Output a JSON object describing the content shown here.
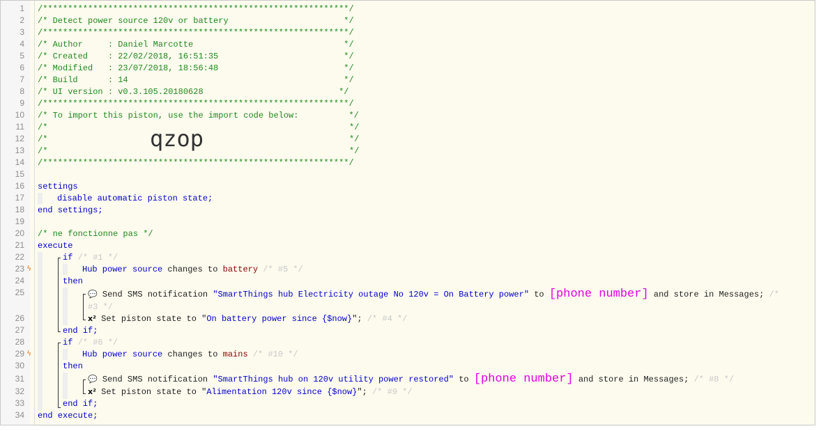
{
  "line_numbers": [
    "1",
    "2",
    "3",
    "4",
    "5",
    "6",
    "7",
    "8",
    "9",
    "10",
    "11",
    "12",
    "13",
    "14",
    "15",
    "16",
    "17",
    "18",
    "19",
    "20",
    "21",
    "22",
    "23",
    "24",
    "25",
    "26",
    "27",
    "28",
    "29",
    "30",
    "31",
    "32",
    "33",
    "34"
  ],
  "header": {
    "stars": "/*************************************************************/",
    "title": "/* Detect power source 120v or battery                       */",
    "author": "/* Author     : Daniel Marcotte                              */",
    "created": "/* Created    : 22/02/2018, 16:51:35                         */",
    "modified": "/* Modified   : 23/07/2018, 18:56:48                         */",
    "build": "/* Build      : 14                                           */",
    "ui_version": "/* UI version : v0.3.105.20180628                           */",
    "import_note": "/* To import this piston, use the import code below:          */",
    "blank_open": "/*",
    "blank_close": "*/",
    "import_code": "qzop"
  },
  "settings": {
    "open": "settings",
    "body": "disable automatic piston state;",
    "close": "end settings;"
  },
  "comment_line": "/* ne fonctionne pas */",
  "execute": {
    "open": "execute",
    "close": "end execute;",
    "if_kw": "if",
    "then_kw": "then",
    "end_if": "end if;",
    "id1": "/* #1 */",
    "id5": "/* #5 */",
    "id3": "/*",
    "id3b": "#3 */",
    "id4": "/* #4 */",
    "id6": "/* #6 */",
    "id10": "/* #10 */",
    "id8": "/* #8 */",
    "id9": "/* #9 */",
    "hub_power_source": "Hub power source",
    "changes_to": "changes to",
    "battery": "battery",
    "mains": "mains",
    "send_sms": "Send SMS notification",
    "msg1": "\"SmartThings hub Electricity outage No 120v = On Battery power\"",
    "msg2": "\"SmartThings hub on 120v utility power restored\"",
    "to": "to",
    "phone": "[phone number]",
    "store": "and store in Messages;",
    "set_state": "Set piston state to",
    "state1_open": "\"",
    "state1": "On battery power since {$now}",
    "state2": "Alimentation 120v since {$now}",
    "state_close": "\";",
    "sms_icon": "💬",
    "var_icon": "x²"
  }
}
